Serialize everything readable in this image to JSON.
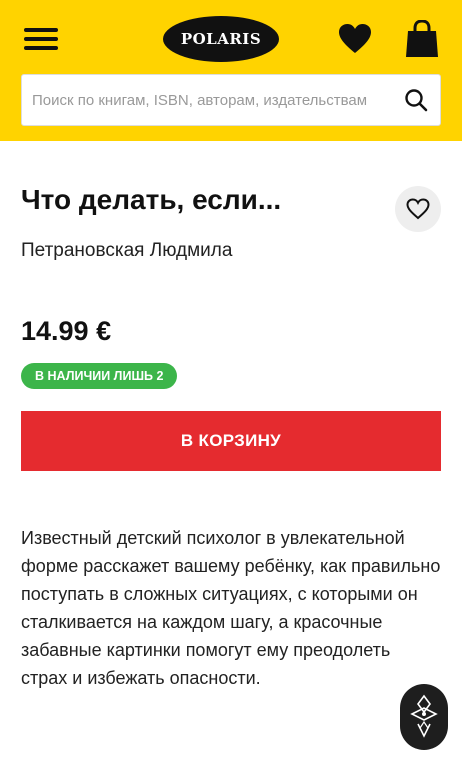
{
  "header": {
    "logo_text": "POLARIS",
    "menu_icon": "hamburger-menu-icon",
    "favorites_icon": "heart-icon",
    "cart_icon": "shopping-bag-icon",
    "colors": {
      "background": "#ffd300",
      "logo_bg": "#111111"
    }
  },
  "search": {
    "placeholder": "Поиск по книгам, ISBN, авторам, издательствам",
    "value": "",
    "icon": "search-icon"
  },
  "product": {
    "title": "Что делать, если...",
    "author": "Петрановская Людмила",
    "price": "14.99 €",
    "stock_badge": "В НАЛИЧИИ ЛИШЬ 2",
    "add_to_cart_label": "В КОРЗИНУ",
    "wishlist_icon": "heart-outline-icon",
    "description": "Известный детский психолог в увлекательной форме расскажет вашему ребёнку, как правильно поступать в сложных ситуациях, с которыми он сталкивается на каждом шагу, а красочные забавные картинки помогут ему преодолеть страх и избежать опасности.",
    "colors": {
      "badge": "#3cb54a",
      "cta": "#e52b2f"
    }
  },
  "widget": {
    "icon": "floating-widget-icon"
  }
}
